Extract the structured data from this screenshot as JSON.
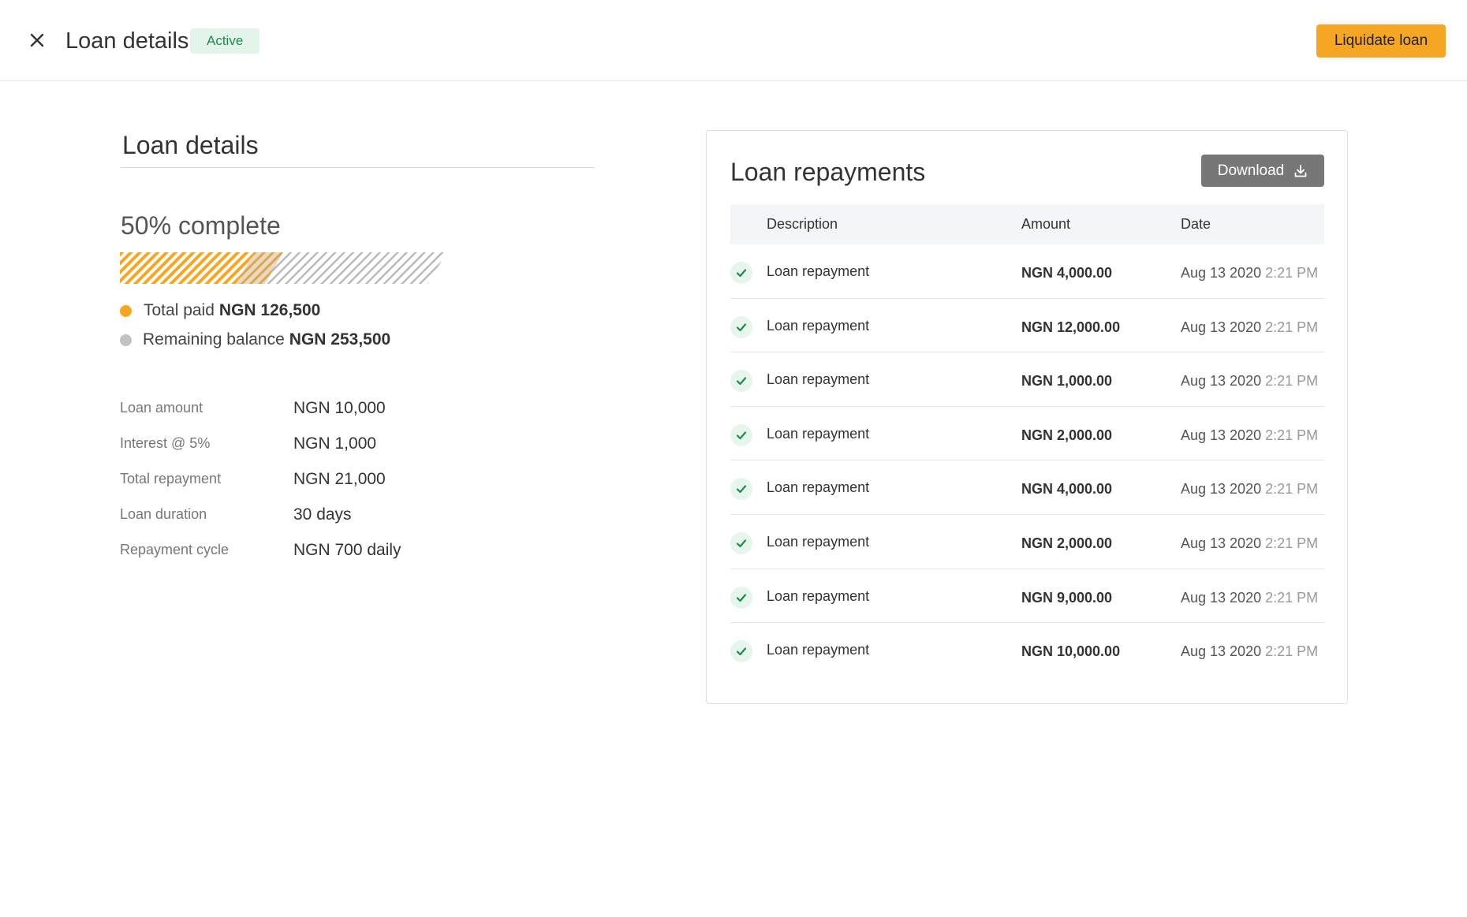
{
  "header": {
    "title": "Loan details",
    "status": "Active",
    "liquidate_label": "Liquidate loan",
    "colors": {
      "accent": "#f5a623",
      "status_bg": "#e3f5ea",
      "status_text": "#1f8a4c"
    }
  },
  "summary": {
    "title": "Loan details",
    "complete_text": "50% complete",
    "progress": {
      "paid_percent": 50
    },
    "total_paid_label": "Total paid",
    "total_paid_value": "NGN 126,500",
    "remaining_label": "Remaining balance",
    "remaining_value": "NGN 253,500",
    "colors": {
      "paid": "#f5a623",
      "remaining": "#c2c2c2"
    }
  },
  "details": [
    {
      "label": "Loan amount",
      "value": "NGN 10,000"
    },
    {
      "label": "Interest @ 5%",
      "value": "NGN 1,000"
    },
    {
      "label": "Total repayment",
      "value": "NGN 21,000"
    },
    {
      "label": "Loan duration",
      "value": "30 days"
    },
    {
      "label": "Repayment cycle",
      "value": "NGN 700 daily"
    }
  ],
  "repayments": {
    "title": "Loan repayments",
    "download_label": "Download",
    "columns": {
      "description": "Description",
      "amount": "Amount",
      "date": "Date"
    },
    "rows": [
      {
        "description": "Loan repayment",
        "amount": "NGN 4,000.00",
        "date": "Aug 13 2020",
        "time": "2:21 PM"
      },
      {
        "description": "Loan repayment",
        "amount": "NGN 12,000.00",
        "date": "Aug 13 2020",
        "time": "2:21 PM"
      },
      {
        "description": "Loan repayment",
        "amount": "NGN 1,000.00",
        "date": "Aug 13 2020",
        "time": "2:21 PM"
      },
      {
        "description": "Loan repayment",
        "amount": "NGN 2,000.00",
        "date": "Aug 13 2020",
        "time": "2:21 PM"
      },
      {
        "description": "Loan repayment",
        "amount": "NGN 4,000.00",
        "date": "Aug 13 2020",
        "time": "2:21 PM"
      },
      {
        "description": "Loan repayment",
        "amount": "NGN 2,000.00",
        "date": "Aug 13 2020",
        "time": "2:21 PM"
      },
      {
        "description": "Loan repayment",
        "amount": "NGN 9,000.00",
        "date": "Aug 13 2020",
        "time": "2:21 PM"
      },
      {
        "description": "Loan repayment",
        "amount": "NGN 10,000.00",
        "date": "Aug 13 2020",
        "time": "2:21 PM"
      }
    ]
  },
  "icons": {
    "close": "close-icon",
    "download": "download-icon",
    "check": "check-icon"
  }
}
